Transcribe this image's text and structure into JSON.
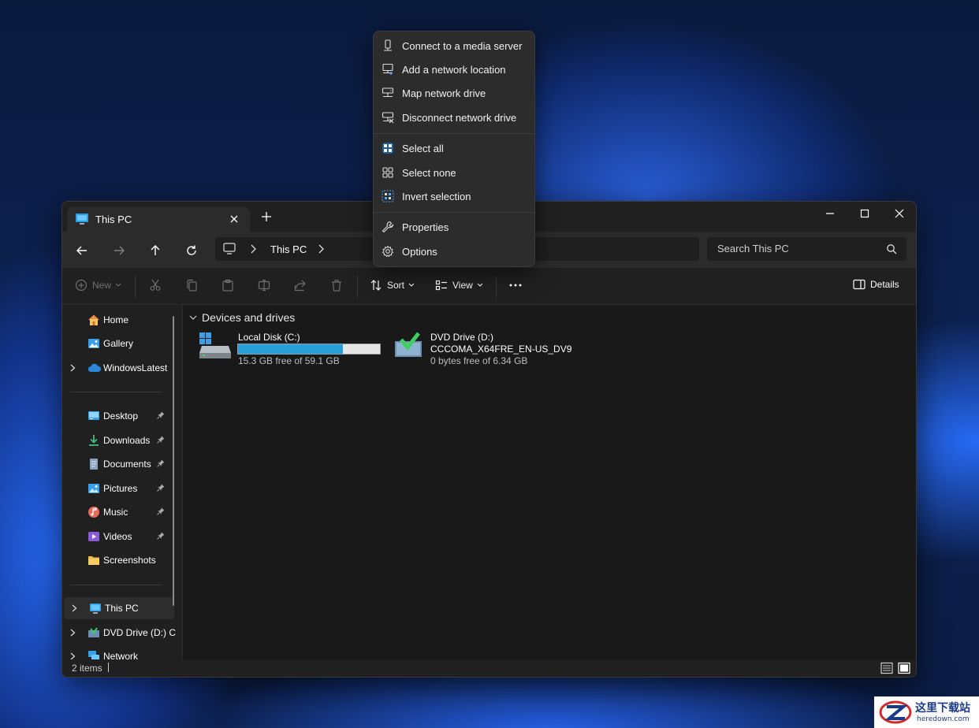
{
  "window": {
    "tab_title": "This PC",
    "tab_icon": "monitor-icon",
    "controls": [
      "minimize-icon",
      "maximize-icon",
      "close-icon"
    ]
  },
  "nav": {
    "address": "This PC",
    "search_placeholder": "Search This PC"
  },
  "toolbar": {
    "new_label": "New",
    "sort_label": "Sort",
    "view_label": "View",
    "details_label": "Details"
  },
  "sidebar": {
    "top": [
      {
        "label": "Home",
        "icon": "home-icon"
      },
      {
        "label": "Gallery",
        "icon": "gallery-icon"
      },
      {
        "label": "WindowsLatest",
        "icon": "cloud-icon"
      }
    ],
    "quick": [
      {
        "label": "Desktop",
        "icon": "desktop-icon"
      },
      {
        "label": "Downloads",
        "icon": "download-icon"
      },
      {
        "label": "Documents",
        "icon": "documents-icon"
      },
      {
        "label": "Pictures",
        "icon": "pictures-icon"
      },
      {
        "label": "Music",
        "icon": "music-icon"
      },
      {
        "label": "Videos",
        "icon": "videos-icon"
      },
      {
        "label": "Screenshots",
        "icon": "folder-icon"
      }
    ],
    "locations": [
      {
        "label": "This PC",
        "icon": "monitor-icon"
      },
      {
        "label": "DVD Drive (D:) C",
        "icon": "dvd-icon"
      },
      {
        "label": "Network",
        "icon": "network-icon"
      }
    ]
  },
  "content": {
    "group_label": "Devices and drives",
    "drives": [
      {
        "name": "Local Disk (C:)",
        "free": "15.3 GB free of 59.1 GB",
        "used_fraction": 0.74
      },
      {
        "name": "DVD Drive (D:)",
        "volume": "CCCOMA_X64FRE_EN-US_DV9",
        "free": "0 bytes free of 6.34 GB"
      }
    ]
  },
  "status": {
    "items": "2 items"
  },
  "menu": {
    "items": [
      {
        "label": "Connect to a media server",
        "icon": "media-server-icon"
      },
      {
        "label": "Add a network location",
        "icon": "network-location-icon"
      },
      {
        "label": "Map network drive",
        "icon": "map-drive-icon"
      },
      {
        "label": "Disconnect network drive",
        "icon": "disconnect-drive-icon"
      },
      {
        "label": "Select all",
        "icon": "select-all-icon"
      },
      {
        "label": "Select none",
        "icon": "select-none-icon"
      },
      {
        "label": "Invert selection",
        "icon": "invert-selection-icon"
      },
      {
        "label": "Properties",
        "icon": "wrench-icon"
      },
      {
        "label": "Options",
        "icon": "gear-icon"
      }
    ]
  },
  "watermark": {
    "cn": "这里下载站",
    "en": "heredown.com"
  },
  "colors": {
    "accent": "#26a0da",
    "window_bg": "#1c1c1c",
    "menu_bg": "#2c2c2c"
  }
}
